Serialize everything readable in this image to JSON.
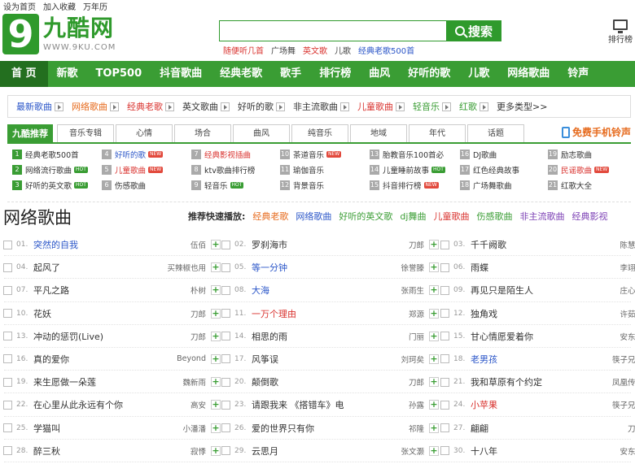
{
  "top_links": [
    "设为首页",
    "加入收藏",
    "万年历"
  ],
  "logo": {
    "digit": "9",
    "cn": "九酷网",
    "en": "WWW.9KU.COM"
  },
  "search": {
    "value": "",
    "placeholder": "",
    "button": "搜索"
  },
  "hot_keys": [
    {
      "text": "随便听几首",
      "color": "red"
    },
    {
      "text": "广场舞",
      "color": "gray"
    },
    {
      "text": "英文歌",
      "color": "red"
    },
    {
      "text": "儿歌",
      "color": "gray"
    },
    {
      "text": "经典老歌500首",
      "color": "blue"
    }
  ],
  "rank_link": "排行榜",
  "nav": [
    "首 页",
    "新歌",
    "TOP500",
    "抖音歌曲",
    "经典老歌",
    "歌手",
    "排行榜",
    "曲风",
    "好听的歌",
    "儿歌",
    "网络歌曲",
    "铃声"
  ],
  "types": [
    {
      "text": "最新歌曲",
      "color": "blue",
      "arrow": true
    },
    {
      "text": "网络歌曲",
      "color": "orange",
      "arrow": true
    },
    {
      "text": "经典老歌",
      "color": "red",
      "arrow": true
    },
    {
      "text": "英文歌曲",
      "color": "dark",
      "arrow": true
    },
    {
      "text": "好听的歌",
      "color": "dark",
      "arrow": true
    },
    {
      "text": "非主流歌曲",
      "color": "dark",
      "arrow": true
    },
    {
      "text": "儿童歌曲",
      "color": "red",
      "arrow": true
    },
    {
      "text": "轻音乐",
      "color": "green",
      "arrow": true
    },
    {
      "text": "红歌",
      "color": "green",
      "arrow": true
    },
    {
      "text": "更多类型>>",
      "color": "dark",
      "arrow": false
    }
  ],
  "tabs": [
    "九酷推荐",
    "音乐专辑",
    "心情",
    "场合",
    "曲风",
    "纯音乐",
    "地域",
    "年代",
    "话题"
  ],
  "tab_ring": "免费手机铃声",
  "categories": [
    [
      {
        "n": "1",
        "text": "经典老歌500首",
        "color": "dark",
        "badge": ""
      },
      {
        "n": "4",
        "text": "好听的歌",
        "color": "blue",
        "badge": "NEW"
      },
      {
        "n": "7",
        "text": "经典影视插曲",
        "color": "red",
        "badge": ""
      },
      {
        "n": "10",
        "text": "茶道音乐",
        "color": "dark",
        "badge": "NEW"
      },
      {
        "n": "13",
        "text": "胎教音乐100首必",
        "color": "dark",
        "badge": ""
      },
      {
        "n": "16",
        "text": "DJ歌曲",
        "color": "dark",
        "badge": ""
      },
      {
        "n": "19",
        "text": "励志歌曲",
        "color": "dark",
        "badge": ""
      }
    ],
    [
      {
        "n": "2",
        "text": "网络流行歌曲",
        "color": "dark",
        "badge": "HOT"
      },
      {
        "n": "5",
        "text": "儿童歌曲",
        "color": "red",
        "badge": "NEW"
      },
      {
        "n": "8",
        "text": "ktv歌曲排行榜",
        "color": "dark",
        "badge": ""
      },
      {
        "n": "11",
        "text": "瑜伽音乐",
        "color": "dark",
        "badge": ""
      },
      {
        "n": "14",
        "text": "儿童睡前故事",
        "color": "dark",
        "badge": "HOT"
      },
      {
        "n": "17",
        "text": "红色经典故事",
        "color": "dark",
        "badge": ""
      },
      {
        "n": "20",
        "text": "民谣歌曲",
        "color": "red",
        "badge": "NEW"
      }
    ],
    [
      {
        "n": "3",
        "text": "好听的英文歌",
        "color": "dark",
        "badge": "HOT"
      },
      {
        "n": "6",
        "text": "伤感歌曲",
        "color": "dark",
        "badge": ""
      },
      {
        "n": "9",
        "text": "轻音乐",
        "color": "dark",
        "badge": "HOT"
      },
      {
        "n": "12",
        "text": "背景音乐",
        "color": "dark",
        "badge": ""
      },
      {
        "n": "15",
        "text": "抖音排行榜",
        "color": "dark",
        "badge": "NEW"
      },
      {
        "n": "18",
        "text": "广场舞歌曲",
        "color": "dark",
        "badge": ""
      },
      {
        "n": "21",
        "text": "红歌大全",
        "color": "dark",
        "badge": ""
      }
    ]
  ],
  "list_title": "网络歌曲",
  "quick": {
    "label": "推荐快速播放:",
    "items": [
      {
        "text": "经典老歌",
        "color": "orange"
      },
      {
        "text": "网络歌曲",
        "color": "blue"
      },
      {
        "text": "好听的英文歌",
        "color": "green"
      },
      {
        "text": "dj舞曲",
        "color": "green"
      },
      {
        "text": "儿童歌曲",
        "color": "red"
      },
      {
        "text": "伤感歌曲",
        "color": "green"
      },
      {
        "text": "非主流歌曲",
        "color": "purple"
      },
      {
        "text": "经典影视",
        "color": "purple"
      }
    ]
  },
  "songs": [
    {
      "no": "01.",
      "title": "突然的自我",
      "artist": "伍佰",
      "color": "blue"
    },
    {
      "no": "02.",
      "title": "罗刹海市",
      "artist": "刀郎",
      "color": ""
    },
    {
      "no": "03.",
      "title": "千千阙歌",
      "artist": "陈慧娴",
      "color": ""
    },
    {
      "no": "04.",
      "title": "起风了",
      "artist": "买辣椒也用",
      "color": ""
    },
    {
      "no": "05.",
      "title": "等一分钟",
      "artist": "徐誉滕",
      "color": "blue"
    },
    {
      "no": "06.",
      "title": "雨蝶",
      "artist": "李翊君",
      "color": ""
    },
    {
      "no": "07.",
      "title": "平凡之路",
      "artist": "朴树",
      "color": ""
    },
    {
      "no": "08.",
      "title": "大海",
      "artist": "张雨生",
      "color": "blue"
    },
    {
      "no": "09.",
      "title": "再见只是陌生人",
      "artist": "庄心妍",
      "color": ""
    },
    {
      "no": "10.",
      "title": "花妖",
      "artist": "刀郎",
      "color": ""
    },
    {
      "no": "11.",
      "title": "一万个理由",
      "artist": "郑源",
      "color": "red"
    },
    {
      "no": "12.",
      "title": "独角戏",
      "artist": "许茹芸",
      "color": ""
    },
    {
      "no": "13.",
      "title": "冲动的惩罚(Live)",
      "artist": "刀郎",
      "color": ""
    },
    {
      "no": "14.",
      "title": "相思的雨",
      "artist": "门丽",
      "color": ""
    },
    {
      "no": "15.",
      "title": "甘心情愿爱着你",
      "artist": "安东阳",
      "color": ""
    },
    {
      "no": "16.",
      "title": "真的爱你",
      "artist": "Beyond",
      "color": ""
    },
    {
      "no": "17.",
      "title": "风筝误",
      "artist": "刘珂矣",
      "color": ""
    },
    {
      "no": "18.",
      "title": "老男孩",
      "artist": "筷子兄弟",
      "color": "blue"
    },
    {
      "no": "19.",
      "title": "来生愿做一朵莲",
      "artist": "魏新雨",
      "color": ""
    },
    {
      "no": "20.",
      "title": "颠倒歌",
      "artist": "刀郎",
      "color": ""
    },
    {
      "no": "21.",
      "title": "我和草原有个约定",
      "artist": "凤凰传奇",
      "color": ""
    },
    {
      "no": "22.",
      "title": "在心里从此永远有个你",
      "artist": "高安",
      "color": ""
    },
    {
      "no": "23.",
      "title": "请跟我来 《搭错车》电",
      "artist": "孙露",
      "color": ""
    },
    {
      "no": "24.",
      "title": "小苹果",
      "artist": "筷子兄弟",
      "color": "red"
    },
    {
      "no": "25.",
      "title": "学猫叫",
      "artist": "小潘潘",
      "color": ""
    },
    {
      "no": "26.",
      "title": "爱的世界只有你",
      "artist": "祁隆",
      "color": ""
    },
    {
      "no": "27.",
      "title": "翩翩",
      "artist": "刀郎",
      "color": ""
    },
    {
      "no": "28.",
      "title": "醉三秋",
      "artist": "寂悸",
      "color": ""
    },
    {
      "no": "29.",
      "title": "云思月",
      "artist": "张文灏",
      "color": ""
    },
    {
      "no": "30.",
      "title": "十八年",
      "artist": "安东阳",
      "color": ""
    }
  ],
  "colors": {
    "brand_green": "#3a9d34",
    "nav_active": "#236f1f",
    "link_blue": "#2b56c8",
    "link_red": "#d9322e",
    "orange": "#e66a1c"
  }
}
